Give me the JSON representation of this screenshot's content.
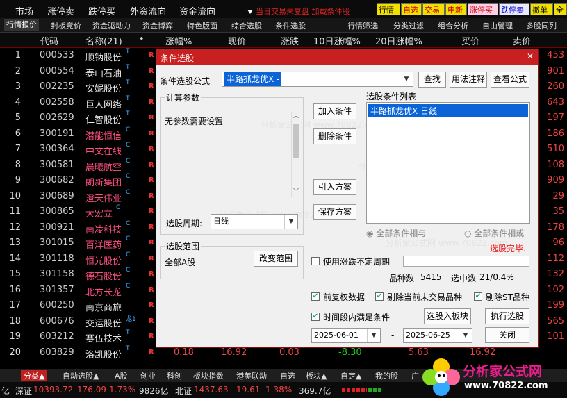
{
  "topmenu": {
    "items": [
      "市场",
      "涨停卖",
      "跌停买",
      "外资流向",
      "资金流向"
    ],
    "marquee": "当日交易未复盘 加载条件股"
  },
  "topbuttons": [
    {
      "label": "行情",
      "bg": "#f0e000",
      "fg": "#000"
    },
    {
      "label": "自选",
      "bg": "#f0e000",
      "fg": "#c00"
    },
    {
      "label": "交易",
      "bg": "#f0e000",
      "fg": "#c00"
    },
    {
      "label": "申新",
      "bg": "#f0e000",
      "fg": "#c00"
    },
    {
      "label": "涨停买",
      "bg": "#ffd0e8",
      "fg": "#c00"
    },
    {
      "label": "跌停卖",
      "bg": "#e8e8ff",
      "fg": "#00c"
    },
    {
      "label": "撤单",
      "bg": "#f0e000",
      "fg": "#000"
    },
    {
      "label": "全",
      "bg": "#f0e000",
      "fg": "#000"
    }
  ],
  "tabs": [
    "行情报价",
    "封板竞价",
    "资金驱动力",
    "资金博弈",
    "特色版面",
    "综合选股",
    "条件选股",
    "行情筛选",
    "分类过滤",
    "组合分析",
    "自由管理",
    "多股同列"
  ],
  "columns": {
    "code": "代码",
    "name": "名称(21)",
    "dot": "•",
    "pct": "涨幅%",
    "price": "现价",
    "chg": "涨跌",
    "pct10": "10日涨幅%",
    "pct20": "20日涨幅%",
    "bid": "买价",
    "ask": "卖价"
  },
  "rows": [
    {
      "n": "1",
      "code": "000533",
      "name": "顺钠股份",
      "sup": "T",
      "color": "#e8e8e8",
      "ask": "453"
    },
    {
      "n": "2",
      "code": "000554",
      "name": "泰山石油",
      "sup": "T",
      "color": "#e8e8e8",
      "ask": "901"
    },
    {
      "n": "3",
      "code": "002235",
      "name": "安妮股份",
      "sup": "T",
      "color": "#e8e8e8",
      "ask": "260"
    },
    {
      "n": "4",
      "code": "002558",
      "name": "巨人网络",
      "sup": "T",
      "color": "#e8e8e8",
      "ask": "643"
    },
    {
      "n": "5",
      "code": "002629",
      "name": "仁智股份",
      "sup": "T",
      "color": "#e8e8e8",
      "ask": "197"
    },
    {
      "n": "6",
      "code": "300191",
      "name": "潜能恒信",
      "sup": "C",
      "color": "#ff5080",
      "ask": "186"
    },
    {
      "n": "7",
      "code": "300364",
      "name": "中文在线",
      "sup": "C",
      "color": "#ff5080",
      "ask": "510"
    },
    {
      "n": "8",
      "code": "300581",
      "name": "晨曦航空",
      "sup": "C",
      "color": "#ff5080",
      "ask": "108"
    },
    {
      "n": "9",
      "code": "300682",
      "name": "朗新集团",
      "sup": "C",
      "color": "#ff5080",
      "ask": "909"
    },
    {
      "n": "10",
      "code": "300689",
      "name": "澄天伟业",
      "sup": "C",
      "color": "#ff5080",
      "ask": "29"
    },
    {
      "n": "11",
      "code": "300865",
      "name": "大宏立",
      "sup": "C",
      "color": "#ff5080",
      "ask": "35"
    },
    {
      "n": "12",
      "code": "300921",
      "name": "南凌科技",
      "sup": "C",
      "color": "#ff5080",
      "ask": "178"
    },
    {
      "n": "13",
      "code": "301015",
      "name": "百洋医药",
      "sup": "C",
      "color": "#ff5080",
      "ask": "96"
    },
    {
      "n": "14",
      "code": "301118",
      "name": "恒光股份",
      "sup": "C",
      "color": "#ff5080",
      "ask": "112"
    },
    {
      "n": "15",
      "code": "301158",
      "name": "德石股份",
      "sup": "C",
      "color": "#ff5080",
      "ask": "132"
    },
    {
      "n": "16",
      "code": "301357",
      "name": "北方长龙",
      "sup": "C",
      "color": "#ff5080",
      "ask": "102"
    },
    {
      "n": "17",
      "code": "600250",
      "name": "南京商旅",
      "sup": "",
      "color": "#e8e8e8",
      "ask": "199"
    },
    {
      "n": "18",
      "code": "600676",
      "name": "交运股份",
      "sup": "龙1",
      "color": "#e8e8e8",
      "ask": "565"
    },
    {
      "n": "19",
      "code": "603212",
      "name": "赛伍技术",
      "sup": "T",
      "color": "#e8e8e8",
      "ask": "101"
    },
    {
      "n": "20",
      "code": "603829",
      "name": "洛凯股份",
      "sup": "T",
      "color": "#e8e8e8",
      "ask": "",
      "pct": "0.18",
      "price": "16.92",
      "chg": "0.03",
      "pct10": "-8.30",
      "pct20": "5.63",
      "bid": "16.92"
    }
  ],
  "dialog": {
    "title": "条件选股",
    "formula_label": "条件选股公式",
    "formula_value": "半路抓龙优X  -",
    "find": "查找",
    "usage": "用法注释",
    "view": "查看公式",
    "params_title": "计算参数",
    "params_text": "无参数需要设置",
    "period_label": "选股周期:",
    "period_value": "日线",
    "add": "加入条件",
    "remove": "删除条件",
    "import": "引入方案",
    "save": "保存方案",
    "cond_list_title": "选股条件列表",
    "cond_item": "半路抓龙优X  日线",
    "radio_and": "全部条件相与",
    "radio_or": "全部条件相或",
    "done": "选股完毕.",
    "range_title": "选股范围",
    "range_value": "全部A股",
    "change_range": "改变范围",
    "use_period": "使用涨跌不定周期",
    "count_label": "品种数",
    "count_value": "5415",
    "selected_label": "选中数",
    "selected_value": "21/0.4%",
    "opt1": "前复权数据",
    "opt2": "剔除当前未交易品种",
    "opt3": "剔除ST品种",
    "time_cond": "时间段内满足条件",
    "to_block": "选股入板块",
    "execute": "执行选股",
    "date_from": "2025-06-01",
    "dash": "-",
    "date_to": "2025-06-25",
    "close": "关闭",
    "min": "—",
    "x": "✕"
  },
  "bottomtabs": [
    "分类▲",
    "自动选股▲",
    "A股",
    "创业",
    "科创",
    "板块指数",
    "港美联动",
    "自选",
    "板块▲",
    "自定▲",
    "我的股",
    "广"
  ],
  "status": {
    "a": "亿",
    "sz_label": "深证",
    "sz_val": "10393.72",
    "sz_chg": "176.09",
    "sz_pct": "1.73%",
    "sz_amt": "9826亿",
    "bz_label": "北证",
    "bz_val": "1437.63",
    "bz_chg": "19.61",
    "bz_pct": "1.38%",
    "bz_amt": "369.7亿"
  },
  "logo": {
    "title": "分析家公式网",
    "url": "www.70822.com"
  }
}
